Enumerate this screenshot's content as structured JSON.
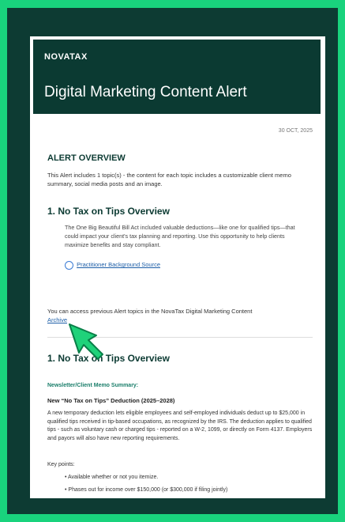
{
  "brand": "NOVATAX",
  "header_title": "Digital Marketing Content Alert",
  "date": "30 OCT, 2025",
  "overview_heading": "ALERT OVERVIEW",
  "overview_text": "This Alert includes 1 topic(s) - the content for each topic includes a customizable client memo summary, social media posts and an image.",
  "topic_heading": "1. No Tax on Tips Overview",
  "topic_text": "The One Big Beautiful Bill Act included valuable deductions—like one for qualified tips—that could impact your client's tax planning and reporting. Use this opportunity to help clients maximize benefits and stay compliant.",
  "source_link": "Practitioner Background Source",
  "archive_text": "You can access previous Alert topics in the NovaTax Digital Marketing Content",
  "archive_link": "Archive",
  "topic2_heading": "1. No Tax on Tips Overview",
  "memo_label": "Newsletter/Client Memo Summary:",
  "memo_title": "New “No Tax on Tips” Deduction (2025–2028)",
  "memo_text": "A new temporary deduction lets eligible employees and self-employed individuals deduct up to $25,000 in qualified tips received in tip-based occupations, as recognized by the IRS. The deduction applies to qualified tips - such as voluntary cash or charged tips - reported on a W-2, 1099, or directly on Form 4137. Employers and payors will also have new reporting requirements.",
  "key_points_label": "Key points:",
  "bullets": [
    "Available whether or not you itemize.",
    "Phases out for income over $150,000 (or $300,000 if filing jointly)"
  ],
  "colors": {
    "background": "#19d37d",
    "frame": "#0d3b33",
    "header": "#0b3a32",
    "link": "#1e5fa8",
    "pointer": "#1fd27a"
  }
}
